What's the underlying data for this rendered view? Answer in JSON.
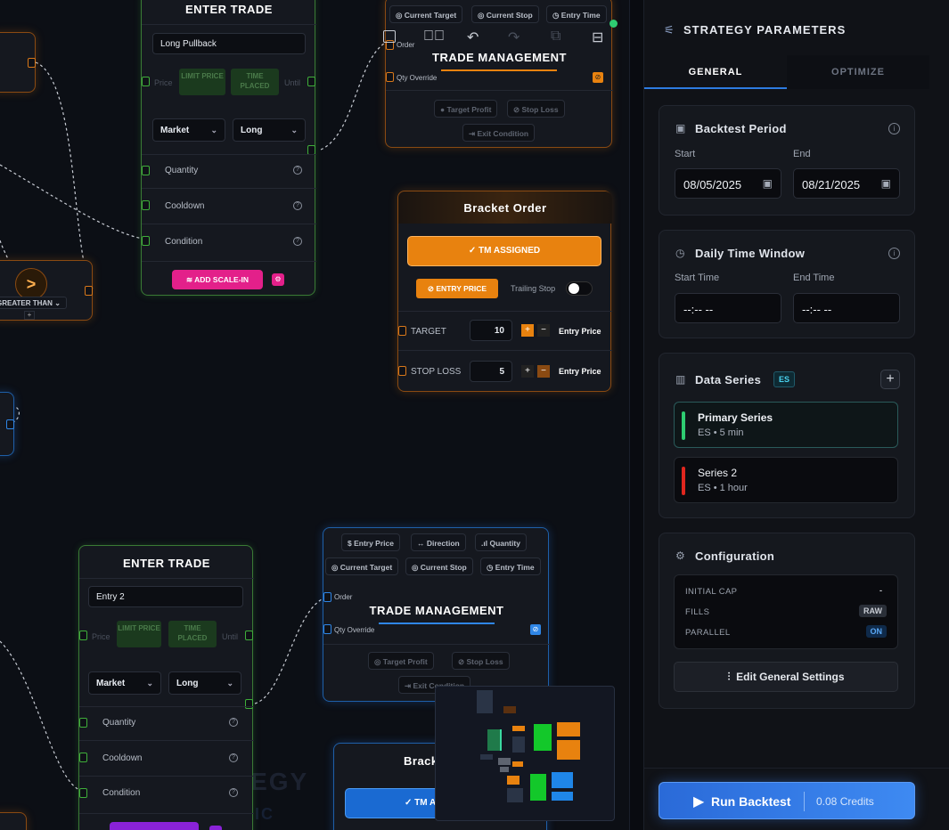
{
  "canvas": {
    "watermark": "TEGY",
    "watermark2": "IC",
    "left_node": {
      "label": "GREATER THAN",
      "symbol": ">"
    },
    "enter_trade_1": {
      "title": "ENTER TRADE",
      "name_value": "Long Pullback",
      "price_label": "Price",
      "limit_price": "LIMIT PRICE",
      "time_placed": "TIME PLACED",
      "until_label": "Until",
      "order_type": "Market",
      "direction": "Long",
      "rows": [
        "Quantity",
        "Cooldown",
        "Condition"
      ],
      "add_scale_in": "ADD SCALE-IN"
    },
    "trade_mgmt_1": {
      "chips": [
        "Current Target",
        "Current Stop",
        "Entry Time"
      ],
      "order_label": "Order",
      "title": "TRADE MANAGEMENT",
      "qty_override": "Qty Override",
      "target_profit": "Target Profit",
      "stop_loss": "Stop Loss",
      "exit_condition": "Exit Condition"
    },
    "bracket_order": {
      "title": "Bracket Order",
      "tm_assigned": "✓ TM ASSIGNED",
      "entry_price_btn": "ENTRY PRICE",
      "trailing_stop": "Trailing Stop",
      "target_label": "TARGET",
      "target_value": "10",
      "target_ref": "Entry Price",
      "stop_label": "STOP LOSS",
      "stop_value": "5",
      "stop_ref": "Entry Price"
    },
    "enter_trade_2": {
      "title": "ENTER TRADE",
      "name_value": "Entry 2",
      "price_label": "Price",
      "limit_price": "LIMIT PRICE",
      "time_placed": "TIME PLACED",
      "until_label": "Until",
      "order_type": "Market",
      "direction": "Long",
      "rows": [
        "Quantity",
        "Cooldown",
        "Condition"
      ]
    },
    "trade_mgmt_2": {
      "chips_row1": [
        "Entry Price",
        "Direction",
        "Quantity"
      ],
      "chips_row2": [
        "Current Target",
        "Current Stop",
        "Entry Time"
      ],
      "order_label": "Order",
      "title": "TRADE MANAGEMENT",
      "qty_override": "Qty Override",
      "target_profit": "Target Profit",
      "stop_loss": "Stop Loss",
      "exit_condition": "Exit Condition"
    },
    "bracket_order_2": {
      "title": "Brack",
      "tm_assigned": "✓ TM A"
    }
  },
  "panel": {
    "title": "STRATEGY PARAMETERS",
    "tabs": [
      "GENERAL",
      "OPTIMIZE"
    ],
    "backtest": {
      "title": "Backtest Period",
      "start_label": "Start",
      "end_label": "End",
      "start_value": "08/05/2025",
      "end_value": "08/21/2025"
    },
    "time_window": {
      "title": "Daily Time Window",
      "start_label": "Start Time",
      "end_label": "End Time",
      "start_value": "--:-- --",
      "end_value": "--:-- --"
    },
    "data_series": {
      "title": "Data Series",
      "badge": "ES",
      "items": [
        {
          "name": "Primary Series",
          "sub": "ES • 5 min",
          "color": "#2ecc71"
        },
        {
          "name": "Series 2",
          "sub": "ES • 1 hour",
          "color": "#e0261e"
        }
      ]
    },
    "configuration": {
      "title": "Configuration",
      "rows": [
        {
          "label": "INITIAL CAP",
          "value": "-"
        },
        {
          "label": "FILLS",
          "value": "RAW"
        },
        {
          "label": "PARALLEL",
          "value": "ON"
        }
      ],
      "edit_button": "Edit General Settings"
    },
    "run": {
      "label": "Run Backtest",
      "credits": "0.08 Credits"
    }
  },
  "colors": {
    "accent_blue": "#2d7be0",
    "accent_orange": "#e8820f",
    "accent_green": "#3fae3a",
    "accent_pink": "#e3208a"
  }
}
